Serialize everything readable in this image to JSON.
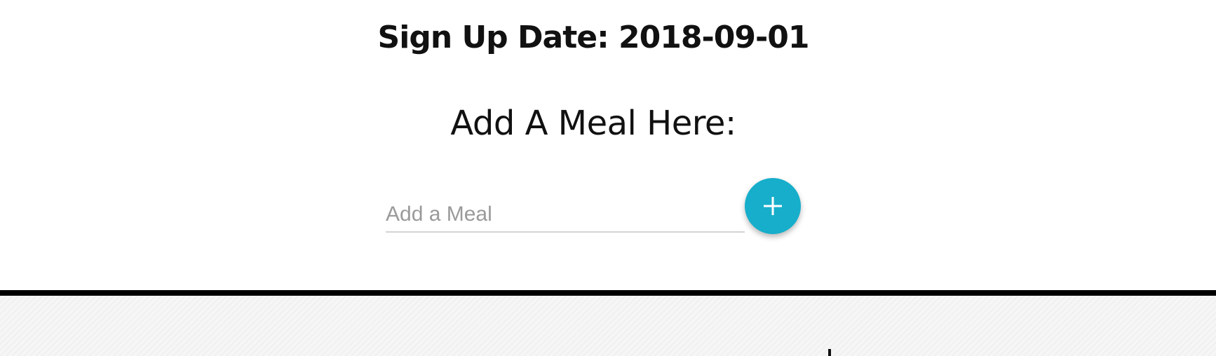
{
  "profile": {
    "signup_label": "Sign Up Date: 2018-09-01"
  },
  "meal_form": {
    "heading": "Add A Meal Here:",
    "input_placeholder": "Add a Meal",
    "input_value": "",
    "add_button_icon": "plus-icon",
    "add_button_color": "#16aecb"
  }
}
